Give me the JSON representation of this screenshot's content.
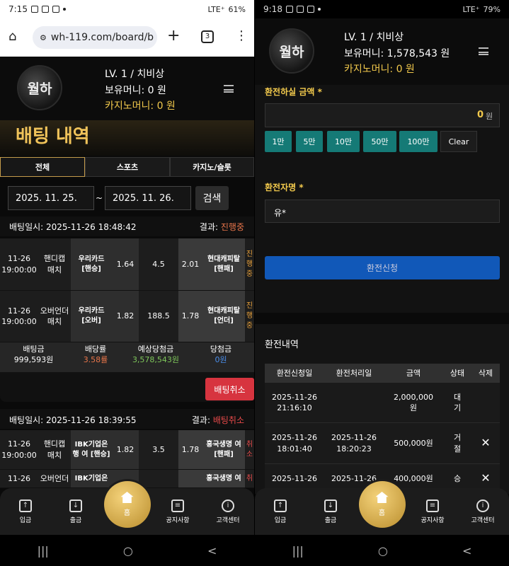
{
  "left": {
    "status": {
      "time": "7:15",
      "signal": "LTE⁺",
      "battery": "61%"
    },
    "browser": {
      "url": "wh-119.com/board/b",
      "tabs": "3"
    },
    "header": {
      "logo": "월하",
      "level": "LV. 1 / 치비상",
      "money": "보유머니: 0 원",
      "casino": "카지노머니: 0 원"
    },
    "page_title": "배팅 내역",
    "tabs": [
      "전체",
      "스포츠",
      "카지노/슬롯"
    ],
    "date_from": "2025. 11. 25.",
    "date_sep": "~",
    "date_to": "2025. 11. 26.",
    "search": "검색",
    "bet1": {
      "time": "배팅일시: 2025-11-26 18:48:42",
      "result_label": "결과: ",
      "result": "진행중",
      "rows": [
        {
          "date": "11-26\n19:00:00",
          "type": "핸디캡\n매치",
          "home": "우리카드\n[핸승]",
          "odds1": "1.64",
          "line": "4.5",
          "odds2": "2.01",
          "away": "현대캐피탈\n[핸패]",
          "status": "진\n행\n중"
        },
        {
          "date": "11-26\n19:00:00",
          "type": "오버언더\n매치",
          "home": "우리카드\n[오버]",
          "odds1": "1.82",
          "line": "188.5",
          "odds2": "1.78",
          "away": "현대캐피탈\n[언더]",
          "status": "진\n행\n중"
        }
      ],
      "summary": [
        {
          "label": "배팅금",
          "value": "999,593원"
        },
        {
          "label": "배당률",
          "value": "3.58률"
        },
        {
          "label": "예상당첨금",
          "value": "3,578,543원"
        },
        {
          "label": "당첨금",
          "value": "0원"
        }
      ],
      "cancel": "배팅취소"
    },
    "bet2": {
      "time": "배팅일시: 2025-11-26 18:39:55",
      "result_label": "결과: ",
      "result": "배팅취소",
      "rows": [
        {
          "date": "11-26\n19:00:00",
          "type": "핸디캡\n매치",
          "home": "IBK기업은\n행 여 [핸승]",
          "odds1": "1.82",
          "line": "3.5",
          "odds2": "1.78",
          "away": "흥국생명 여\n[핸패]",
          "status": "취\n소"
        },
        {
          "date": "11-26",
          "type": "오버언더",
          "home": "IBK기업은",
          "odds1": "",
          "line": "",
          "odds2": "",
          "away": "흥국생명 여",
          "status": "취"
        }
      ]
    },
    "nav": {
      "deposit": "입금",
      "withdraw": "출금",
      "home": "홈",
      "notice": "공지사항",
      "support": "고객센터"
    }
  },
  "right": {
    "status": {
      "time": "9:18",
      "signal": "LTE⁺",
      "battery": "79%"
    },
    "header": {
      "logo": "월하",
      "level": "LV. 1 / 치비상",
      "money": "보유머니: 1,578,543 원",
      "casino": "카지노머니: 0 원"
    },
    "amount_label": "환전하실 금액 *",
    "amount_value": "0",
    "amount_unit": "원",
    "quick": [
      "1만",
      "5만",
      "10만",
      "50만",
      "100만",
      "Clear"
    ],
    "name_label": "환전자명 *",
    "name_value": "유*",
    "submit": "환전신청",
    "history_title": "환전내역",
    "table_headers": [
      "환전신청일",
      "환전처리일",
      "금액",
      "상태",
      "삭제"
    ],
    "table_rows": [
      {
        "req": "2025-11-26\n21:16:10",
        "done": "",
        "amount": "2,000,000\n원",
        "status": "대\n기",
        "del": ""
      },
      {
        "req": "2025-11-26\n18:01:40",
        "done": "2025-11-26\n18:20:23",
        "amount": "500,000원",
        "status": "거\n절",
        "del": "✕"
      },
      {
        "req": "2025-11-26",
        "done": "2025-11-26",
        "amount": "400,000원",
        "status": "승",
        "del": "✕"
      }
    ],
    "nav": {
      "deposit": "입금",
      "withdraw": "출금",
      "home": "홈",
      "notice": "공지사항",
      "support": "고객센터"
    }
  },
  "sys_nav": [
    "|||",
    "○",
    "<"
  ]
}
